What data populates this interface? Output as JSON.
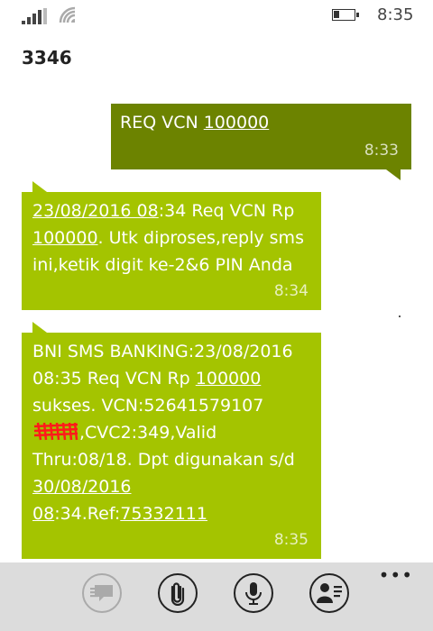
{
  "status": {
    "time": "8:35"
  },
  "contact": {
    "name": "3346"
  },
  "messages": [
    {
      "direction": "outgoing",
      "parts": [
        {
          "text": "REQ VCN ",
          "u": false
        },
        {
          "text": "100000",
          "u": true
        }
      ],
      "time": "8:33"
    },
    {
      "direction": "incoming",
      "parts": [
        {
          "text": "23/08/2016 08",
          "u": true
        },
        {
          "text": ":34 Req VCN Rp ",
          "u": false
        },
        {
          "text": "100000",
          "u": true
        },
        {
          "text": ". Utk diproses,reply sms ini,ketik digit ke-2&6 PIN Anda",
          "u": false
        }
      ],
      "time": "8:34"
    },
    {
      "direction": "incoming",
      "parts": [
        {
          "text": "BNI SMS BANKING:23/08/2016 08:35 Req VCN Rp ",
          "u": false
        },
        {
          "text": "100000",
          "u": true
        },
        {
          "text": " sukses. VCN:52641579107",
          "u": false
        },
        {
          "redacted": true
        },
        {
          "text": ",CVC2:349,Valid Thru:08/18. Dpt digunakan s/d ",
          "u": false
        },
        {
          "text": "30/08/2016 08",
          "u": true
        },
        {
          "text": ":34.Ref:",
          "u": false
        },
        {
          "text": "75332111",
          "u": true
        }
      ],
      "time": "8:35"
    }
  ],
  "appbar": {
    "buttons": [
      "speech-to-text-icon",
      "attach-icon",
      "microphone-icon",
      "contact-info-icon"
    ],
    "more": "•••"
  },
  "colors": {
    "outgoing": "#6c8300",
    "incoming": "#a4c400",
    "appbar": "#dcdcdc",
    "redaction": "#ff1a1a"
  }
}
